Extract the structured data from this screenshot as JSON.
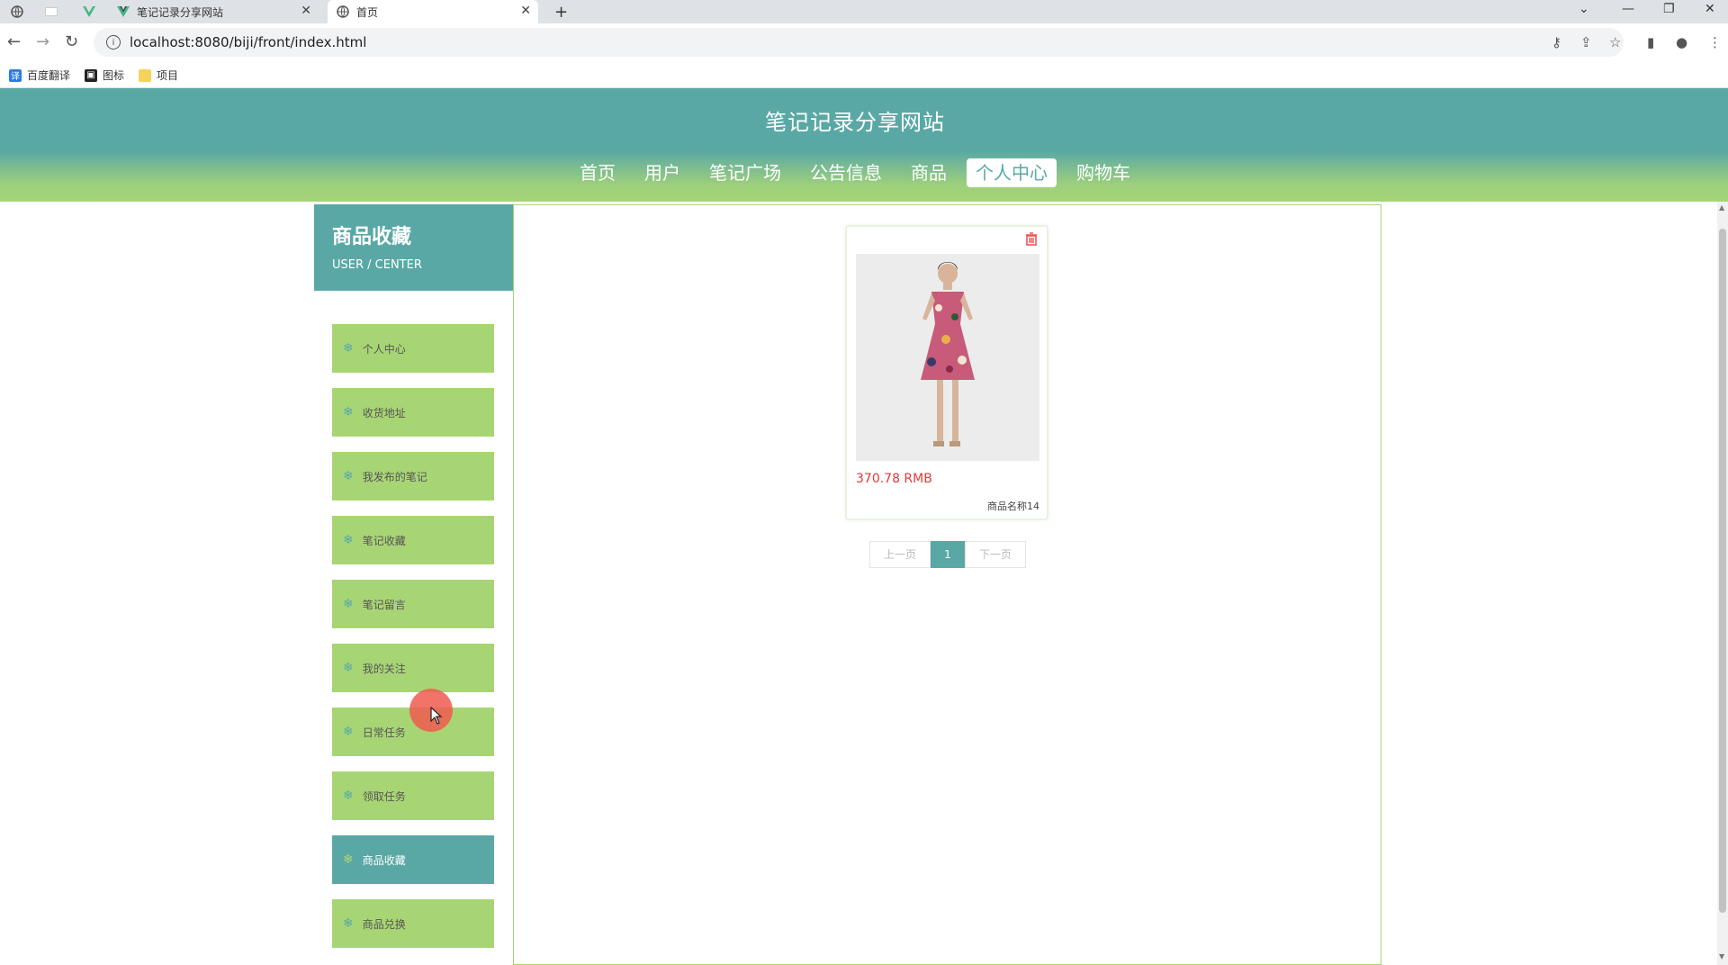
{
  "browser": {
    "tabs": [
      {
        "title": ""
      },
      {
        "title": "笔记记录分享网站"
      },
      {
        "title": "首页"
      }
    ],
    "new_tab": "+",
    "url": "localhost:8080/biji/front/index.html",
    "bookmarks": [
      {
        "label": "百度翻译",
        "icon": "translate-icon"
      },
      {
        "label": "图标",
        "icon": "image-icon"
      },
      {
        "label": "项目",
        "icon": "folder-icon"
      }
    ]
  },
  "site": {
    "title": "笔记记录分享网站",
    "nav": [
      "首页",
      "用户",
      "笔记广场",
      "公告信息",
      "商品",
      "个人中心",
      "购物车"
    ],
    "active_nav": "个人中心"
  },
  "sidebar": {
    "title": "商品收藏",
    "subtitle": "USER / CENTER",
    "items": [
      {
        "label": "个人中心"
      },
      {
        "label": "收货地址"
      },
      {
        "label": "我发布的笔记"
      },
      {
        "label": "笔记收藏"
      },
      {
        "label": "笔记留言"
      },
      {
        "label": "我的关注"
      },
      {
        "label": "日常任务"
      },
      {
        "label": "领取任务"
      },
      {
        "label": "商品收藏"
      },
      {
        "label": "商品兑换"
      }
    ],
    "active_item": "商品收藏"
  },
  "products": [
    {
      "price": "370.78 RMB",
      "name": "商品名称14"
    }
  ],
  "pagination": {
    "prev": "上一页",
    "current": "1",
    "next": "下一页"
  },
  "colors": {
    "primary": "#5aa8a5",
    "secondary": "#a8d574",
    "price": "#e53935"
  }
}
